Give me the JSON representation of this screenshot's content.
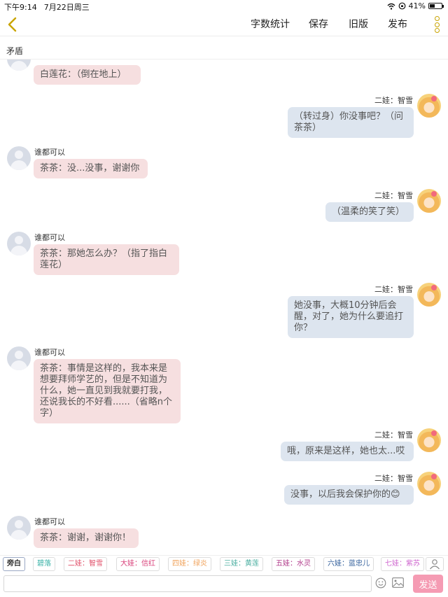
{
  "status_bar": {
    "time": "下午9:14",
    "date": "7月22日周三",
    "battery": "41%",
    "battery_level": 0.41
  },
  "toolbar": {
    "word_count_label": "字数统计",
    "save_label": "保存",
    "old_version_label": "旧版",
    "publish_label": "发布"
  },
  "document": {
    "title": "矛盾"
  },
  "messages": [
    {
      "side": "left",
      "name": "",
      "text": "白莲花：（倒在地上）"
    },
    {
      "side": "right",
      "name": "二娃：智雪",
      "text": "（转过身）你没事吧？（问茶茶）"
    },
    {
      "side": "left",
      "name": "谁都可以",
      "text": "茶茶：没...没事，谢谢你"
    },
    {
      "side": "right",
      "name": "二娃：智雪",
      "text": "（温柔的笑了笑）"
    },
    {
      "side": "left",
      "name": "谁都可以",
      "text": "茶茶：那她怎么办？（指了指白莲花）"
    },
    {
      "side": "right",
      "name": "二娃：智雪",
      "text": "她没事，大概10分钟后会醒，对了，她为什么要追打你？"
    },
    {
      "side": "left",
      "name": "谁都可以",
      "text": "茶茶：事情是这样的，我本来是想要拜师学艺的，但是不知道为什么，她一直见到我就要打我，还说我长的不好看......（省略n个字）"
    },
    {
      "side": "right",
      "name": "二娃：智雪",
      "text": "哦，原来是这样，她也太...哎"
    },
    {
      "side": "right",
      "name": "二娃：智雪",
      "text": "没事，以后我会保护你的😊"
    },
    {
      "side": "left",
      "name": "谁都可以",
      "text": "茶茶：谢谢，谢谢你！"
    }
  ],
  "roles": [
    {
      "label": "旁白",
      "color": "#333333",
      "active": true
    },
    {
      "label": "碧落",
      "color": "#3bb3a8"
    },
    {
      "label": "二娃：智雪",
      "color": "#e0506a"
    },
    {
      "label": "大娃：信红",
      "color": "#d9407a"
    },
    {
      "label": "四娃：绿炎",
      "color": "#f0a25a"
    },
    {
      "label": "三娃：黄莲",
      "color": "#4aaea0"
    },
    {
      "label": "五娃：水灵",
      "color": "#b03a8a"
    },
    {
      "label": "六娃：蓝忠儿",
      "color": "#2f5d9a"
    },
    {
      "label": "七娃：紫苏",
      "color": "#d06ad0"
    }
  ],
  "composer": {
    "placeholder": "",
    "send_label": "发送"
  },
  "colors": {
    "accent": "#c9a400",
    "send_button": "#f59bb3",
    "bubble_left": "#f6dfe0",
    "bubble_right": "#dde5ef"
  }
}
